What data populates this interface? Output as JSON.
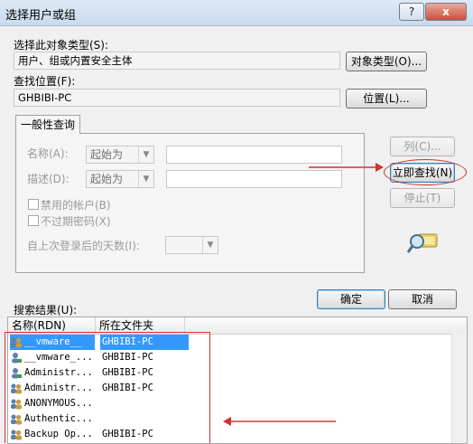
{
  "window": {
    "title": "选择用户或组",
    "help_label": "?",
    "close_label": "x"
  },
  "object_type": {
    "label": "选择此对象类型(S):",
    "value": "用户、组或内置安全主体",
    "button": "对象类型(O)..."
  },
  "location": {
    "label": "查找位置(F):",
    "value": "GHBIBI-PC",
    "button": "位置(L)..."
  },
  "query": {
    "tab_label": "一般性查询",
    "name": {
      "label": "名称(A):",
      "operator": "起始为"
    },
    "description": {
      "label": "描述(D):",
      "operator": "起始为"
    },
    "disabled_accounts_label": "禁用的帐户(B)",
    "no_expire_password_label": "不过期密码(X)",
    "days_since_logon_label": "自上次登录后的天数(I):"
  },
  "buttons": {
    "columns": "列(C)...",
    "find_now": "立即查找(N)",
    "stop": "停止(T)",
    "ok": "确定",
    "cancel": "取消"
  },
  "results": {
    "label": "搜索结果(U):",
    "columns": [
      "名称(RDN)",
      "所在文件夹"
    ],
    "rows": [
      {
        "name": "__vmware__",
        "folder": "GHBIBI-PC",
        "icon": "group-icon",
        "selected": true
      },
      {
        "name": "__vmware_...",
        "folder": "GHBIBI-PC",
        "icon": "user-icon",
        "selected": false
      },
      {
        "name": "Administr...",
        "folder": "GHBIBI-PC",
        "icon": "user-icon",
        "selected": false
      },
      {
        "name": "Administr...",
        "folder": "GHBIBI-PC",
        "icon": "group-icon",
        "selected": false
      },
      {
        "name": "ANONYMOUS...",
        "folder": "",
        "icon": "group-icon",
        "selected": false
      },
      {
        "name": "Authentic...",
        "folder": "",
        "icon": "group-icon",
        "selected": false
      },
      {
        "name": "Backup Op...",
        "folder": "GHBIBI-PC",
        "icon": "group-icon",
        "selected": false
      }
    ]
  },
  "colors": {
    "annotation_red": "#d23232",
    "selection": "#3399ff"
  }
}
